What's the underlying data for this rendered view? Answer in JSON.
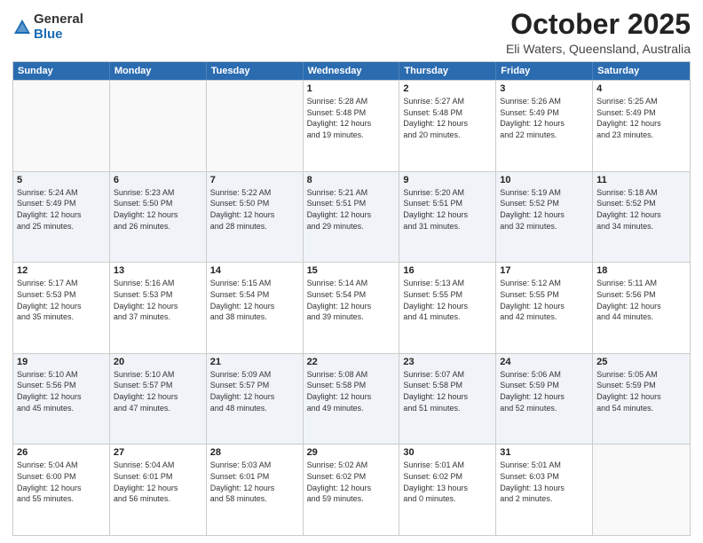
{
  "logo": {
    "general": "General",
    "blue": "Blue"
  },
  "header": {
    "month": "October 2025",
    "location": "Eli Waters, Queensland, Australia"
  },
  "weekdays": [
    "Sunday",
    "Monday",
    "Tuesday",
    "Wednesday",
    "Thursday",
    "Friday",
    "Saturday"
  ],
  "rows": [
    {
      "cells": [
        {
          "day": "",
          "info": ""
        },
        {
          "day": "",
          "info": ""
        },
        {
          "day": "",
          "info": ""
        },
        {
          "day": "1",
          "info": "Sunrise: 5:28 AM\nSunset: 5:48 PM\nDaylight: 12 hours\nand 19 minutes."
        },
        {
          "day": "2",
          "info": "Sunrise: 5:27 AM\nSunset: 5:48 PM\nDaylight: 12 hours\nand 20 minutes."
        },
        {
          "day": "3",
          "info": "Sunrise: 5:26 AM\nSunset: 5:49 PM\nDaylight: 12 hours\nand 22 minutes."
        },
        {
          "day": "4",
          "info": "Sunrise: 5:25 AM\nSunset: 5:49 PM\nDaylight: 12 hours\nand 23 minutes."
        }
      ]
    },
    {
      "cells": [
        {
          "day": "5",
          "info": "Sunrise: 5:24 AM\nSunset: 5:49 PM\nDaylight: 12 hours\nand 25 minutes."
        },
        {
          "day": "6",
          "info": "Sunrise: 5:23 AM\nSunset: 5:50 PM\nDaylight: 12 hours\nand 26 minutes."
        },
        {
          "day": "7",
          "info": "Sunrise: 5:22 AM\nSunset: 5:50 PM\nDaylight: 12 hours\nand 28 minutes."
        },
        {
          "day": "8",
          "info": "Sunrise: 5:21 AM\nSunset: 5:51 PM\nDaylight: 12 hours\nand 29 minutes."
        },
        {
          "day": "9",
          "info": "Sunrise: 5:20 AM\nSunset: 5:51 PM\nDaylight: 12 hours\nand 31 minutes."
        },
        {
          "day": "10",
          "info": "Sunrise: 5:19 AM\nSunset: 5:52 PM\nDaylight: 12 hours\nand 32 minutes."
        },
        {
          "day": "11",
          "info": "Sunrise: 5:18 AM\nSunset: 5:52 PM\nDaylight: 12 hours\nand 34 minutes."
        }
      ]
    },
    {
      "cells": [
        {
          "day": "12",
          "info": "Sunrise: 5:17 AM\nSunset: 5:53 PM\nDaylight: 12 hours\nand 35 minutes."
        },
        {
          "day": "13",
          "info": "Sunrise: 5:16 AM\nSunset: 5:53 PM\nDaylight: 12 hours\nand 37 minutes."
        },
        {
          "day": "14",
          "info": "Sunrise: 5:15 AM\nSunset: 5:54 PM\nDaylight: 12 hours\nand 38 minutes."
        },
        {
          "day": "15",
          "info": "Sunrise: 5:14 AM\nSunset: 5:54 PM\nDaylight: 12 hours\nand 39 minutes."
        },
        {
          "day": "16",
          "info": "Sunrise: 5:13 AM\nSunset: 5:55 PM\nDaylight: 12 hours\nand 41 minutes."
        },
        {
          "day": "17",
          "info": "Sunrise: 5:12 AM\nSunset: 5:55 PM\nDaylight: 12 hours\nand 42 minutes."
        },
        {
          "day": "18",
          "info": "Sunrise: 5:11 AM\nSunset: 5:56 PM\nDaylight: 12 hours\nand 44 minutes."
        }
      ]
    },
    {
      "cells": [
        {
          "day": "19",
          "info": "Sunrise: 5:10 AM\nSunset: 5:56 PM\nDaylight: 12 hours\nand 45 minutes."
        },
        {
          "day": "20",
          "info": "Sunrise: 5:10 AM\nSunset: 5:57 PM\nDaylight: 12 hours\nand 47 minutes."
        },
        {
          "day": "21",
          "info": "Sunrise: 5:09 AM\nSunset: 5:57 PM\nDaylight: 12 hours\nand 48 minutes."
        },
        {
          "day": "22",
          "info": "Sunrise: 5:08 AM\nSunset: 5:58 PM\nDaylight: 12 hours\nand 49 minutes."
        },
        {
          "day": "23",
          "info": "Sunrise: 5:07 AM\nSunset: 5:58 PM\nDaylight: 12 hours\nand 51 minutes."
        },
        {
          "day": "24",
          "info": "Sunrise: 5:06 AM\nSunset: 5:59 PM\nDaylight: 12 hours\nand 52 minutes."
        },
        {
          "day": "25",
          "info": "Sunrise: 5:05 AM\nSunset: 5:59 PM\nDaylight: 12 hours\nand 54 minutes."
        }
      ]
    },
    {
      "cells": [
        {
          "day": "26",
          "info": "Sunrise: 5:04 AM\nSunset: 6:00 PM\nDaylight: 12 hours\nand 55 minutes."
        },
        {
          "day": "27",
          "info": "Sunrise: 5:04 AM\nSunset: 6:01 PM\nDaylight: 12 hours\nand 56 minutes."
        },
        {
          "day": "28",
          "info": "Sunrise: 5:03 AM\nSunset: 6:01 PM\nDaylight: 12 hours\nand 58 minutes."
        },
        {
          "day": "29",
          "info": "Sunrise: 5:02 AM\nSunset: 6:02 PM\nDaylight: 12 hours\nand 59 minutes."
        },
        {
          "day": "30",
          "info": "Sunrise: 5:01 AM\nSunset: 6:02 PM\nDaylight: 13 hours\nand 0 minutes."
        },
        {
          "day": "31",
          "info": "Sunrise: 5:01 AM\nSunset: 6:03 PM\nDaylight: 13 hours\nand 2 minutes."
        },
        {
          "day": "",
          "info": ""
        }
      ]
    }
  ]
}
